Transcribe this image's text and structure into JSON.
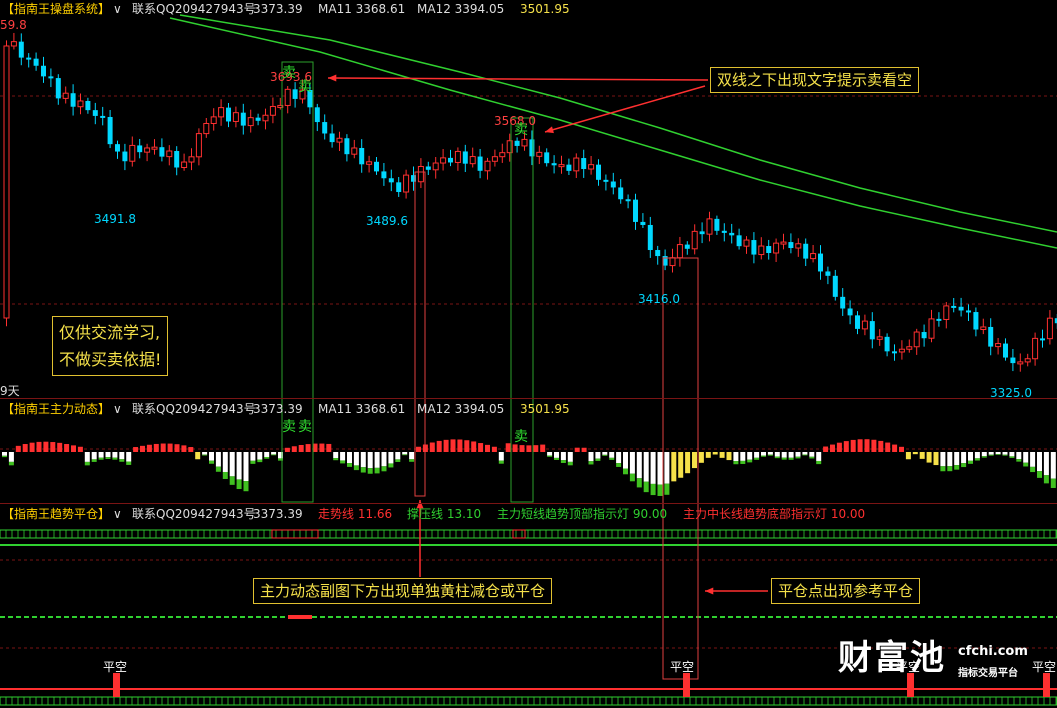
{
  "panels": {
    "main": {
      "name": "【指南王操盘系统】",
      "chevron": "∨",
      "contact": "联系QQ209427943号",
      "price": "3373.39",
      "ma11": "MA11 3368.61",
      "ma12": "MA12 3394.05",
      "extra": "3501.95",
      "left_value": "59.8",
      "left_bottom": "9天"
    },
    "sub1": {
      "name": "【指南王主力动态】",
      "chevron": "∨",
      "contact": "联系QQ209427943号",
      "price": "3373.39",
      "ma11": "MA11 3368.61",
      "ma12": "MA12 3394.05",
      "extra": "3501.95"
    },
    "sub2": {
      "name": "【指南王趋势平仓】",
      "chevron": "∨",
      "contact": "联系QQ209427943号",
      "price": "3373.39",
      "trend_line": "走势线 11.66",
      "press_line": "撑压线 13.10",
      "short_lamp": "主力短线趋势顶部指示灯 90.00",
      "long_lamp": "主力中长线趋势底部指示灯 10.00"
    }
  },
  "price_labels": {
    "high1": "3693.6",
    "high2": "3568.0",
    "low1": "3491.8",
    "low2": "3489.6",
    "low3": "3416.0",
    "low4": "3325.0"
  },
  "signals": {
    "sell": "卖",
    "close_short": "平空"
  },
  "annotations": {
    "sell_tip": "双线之下出现文字提示卖看空",
    "yellow_bar_tip": "主力动态副图下方出现单独黄柱减仓或平仓",
    "close_tip": "平仓点出现参考平仓"
  },
  "disclaimer": {
    "line1": "仅供交流学习,",
    "line2": "不做买卖依据!"
  },
  "logo": {
    "name": "财富池",
    "url": "cfchi.com",
    "tagline": "指标交易平台"
  },
  "colors": {
    "up": "#ff3030",
    "down": "#00d8ff",
    "ma": "#30d030",
    "yellow": "#f5e14a",
    "white_bar": "#ffffff",
    "green_bar": "#40c020"
  }
}
